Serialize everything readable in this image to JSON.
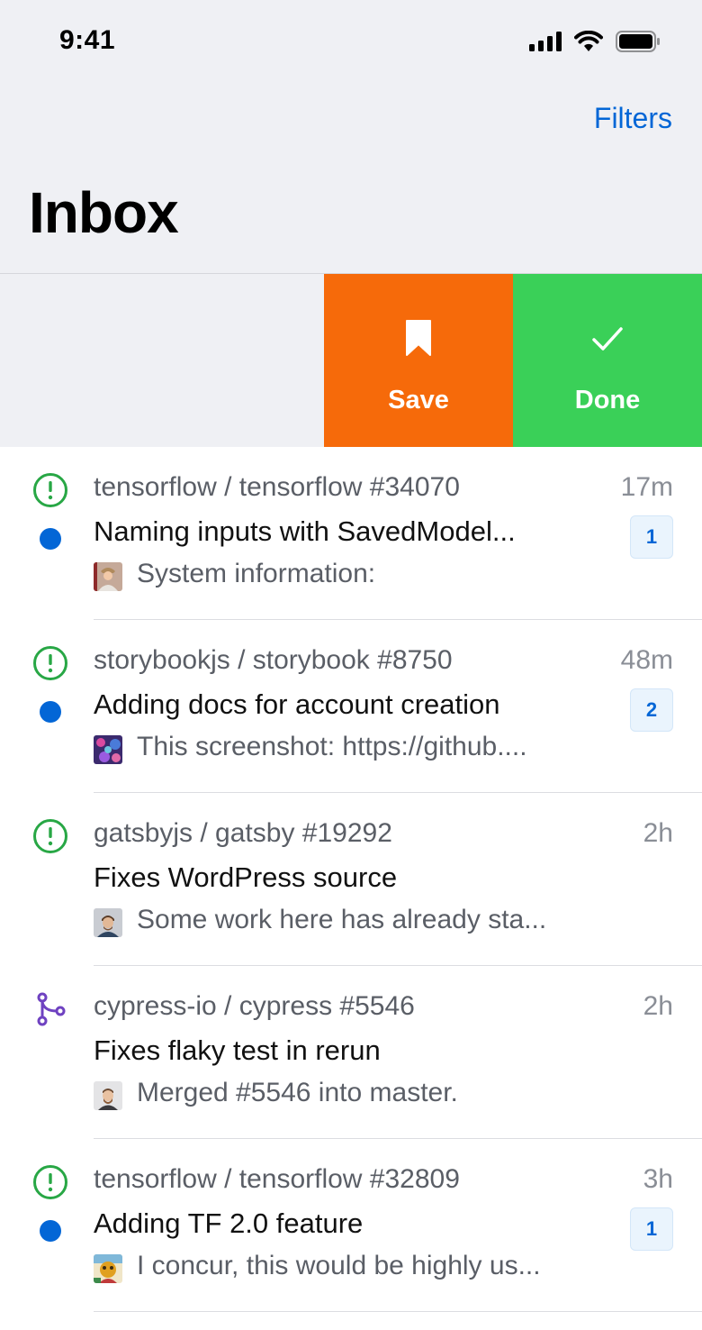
{
  "status": {
    "time": "9:41"
  },
  "nav": {
    "filters_label": "Filters",
    "title": "Inbox"
  },
  "swipe_actions": {
    "save_label": "Save",
    "done_label": "Done",
    "save_color": "#f66a0a",
    "done_color": "#3ad058"
  },
  "notifications": [
    {
      "type": "issue",
      "repo": "tensorflow / tensorflow #34070",
      "age": "17m",
      "title": "Naming inputs with SavedModel...",
      "unread": true,
      "count": "1",
      "snippet": "System information:"
    },
    {
      "type": "issue",
      "repo": "storybookjs / storybook #8750",
      "age": "48m",
      "title": "Adding docs for account creation",
      "unread": true,
      "count": "2",
      "snippet": "This screenshot: https://github...."
    },
    {
      "type": "issue",
      "repo": "gatsbyjs / gatsby #19292",
      "age": "2h",
      "title": "Fixes WordPress source",
      "unread": false,
      "count": "",
      "snippet": "Some work here has already sta..."
    },
    {
      "type": "pull-request",
      "repo": "cypress-io / cypress #5546",
      "age": "2h",
      "title": "Fixes flaky test in rerun",
      "unread": false,
      "count": "",
      "snippet": "Merged #5546 into master."
    },
    {
      "type": "issue",
      "repo": "tensorflow / tensorflow #32809",
      "age": "3h",
      "title": "Adding TF 2.0 feature",
      "unread": true,
      "count": "1",
      "snippet": "I concur, this would be highly us..."
    }
  ],
  "colors": {
    "accent": "#0366d6",
    "issue_green": "#28a745",
    "merged_purple": "#6f42c1"
  }
}
